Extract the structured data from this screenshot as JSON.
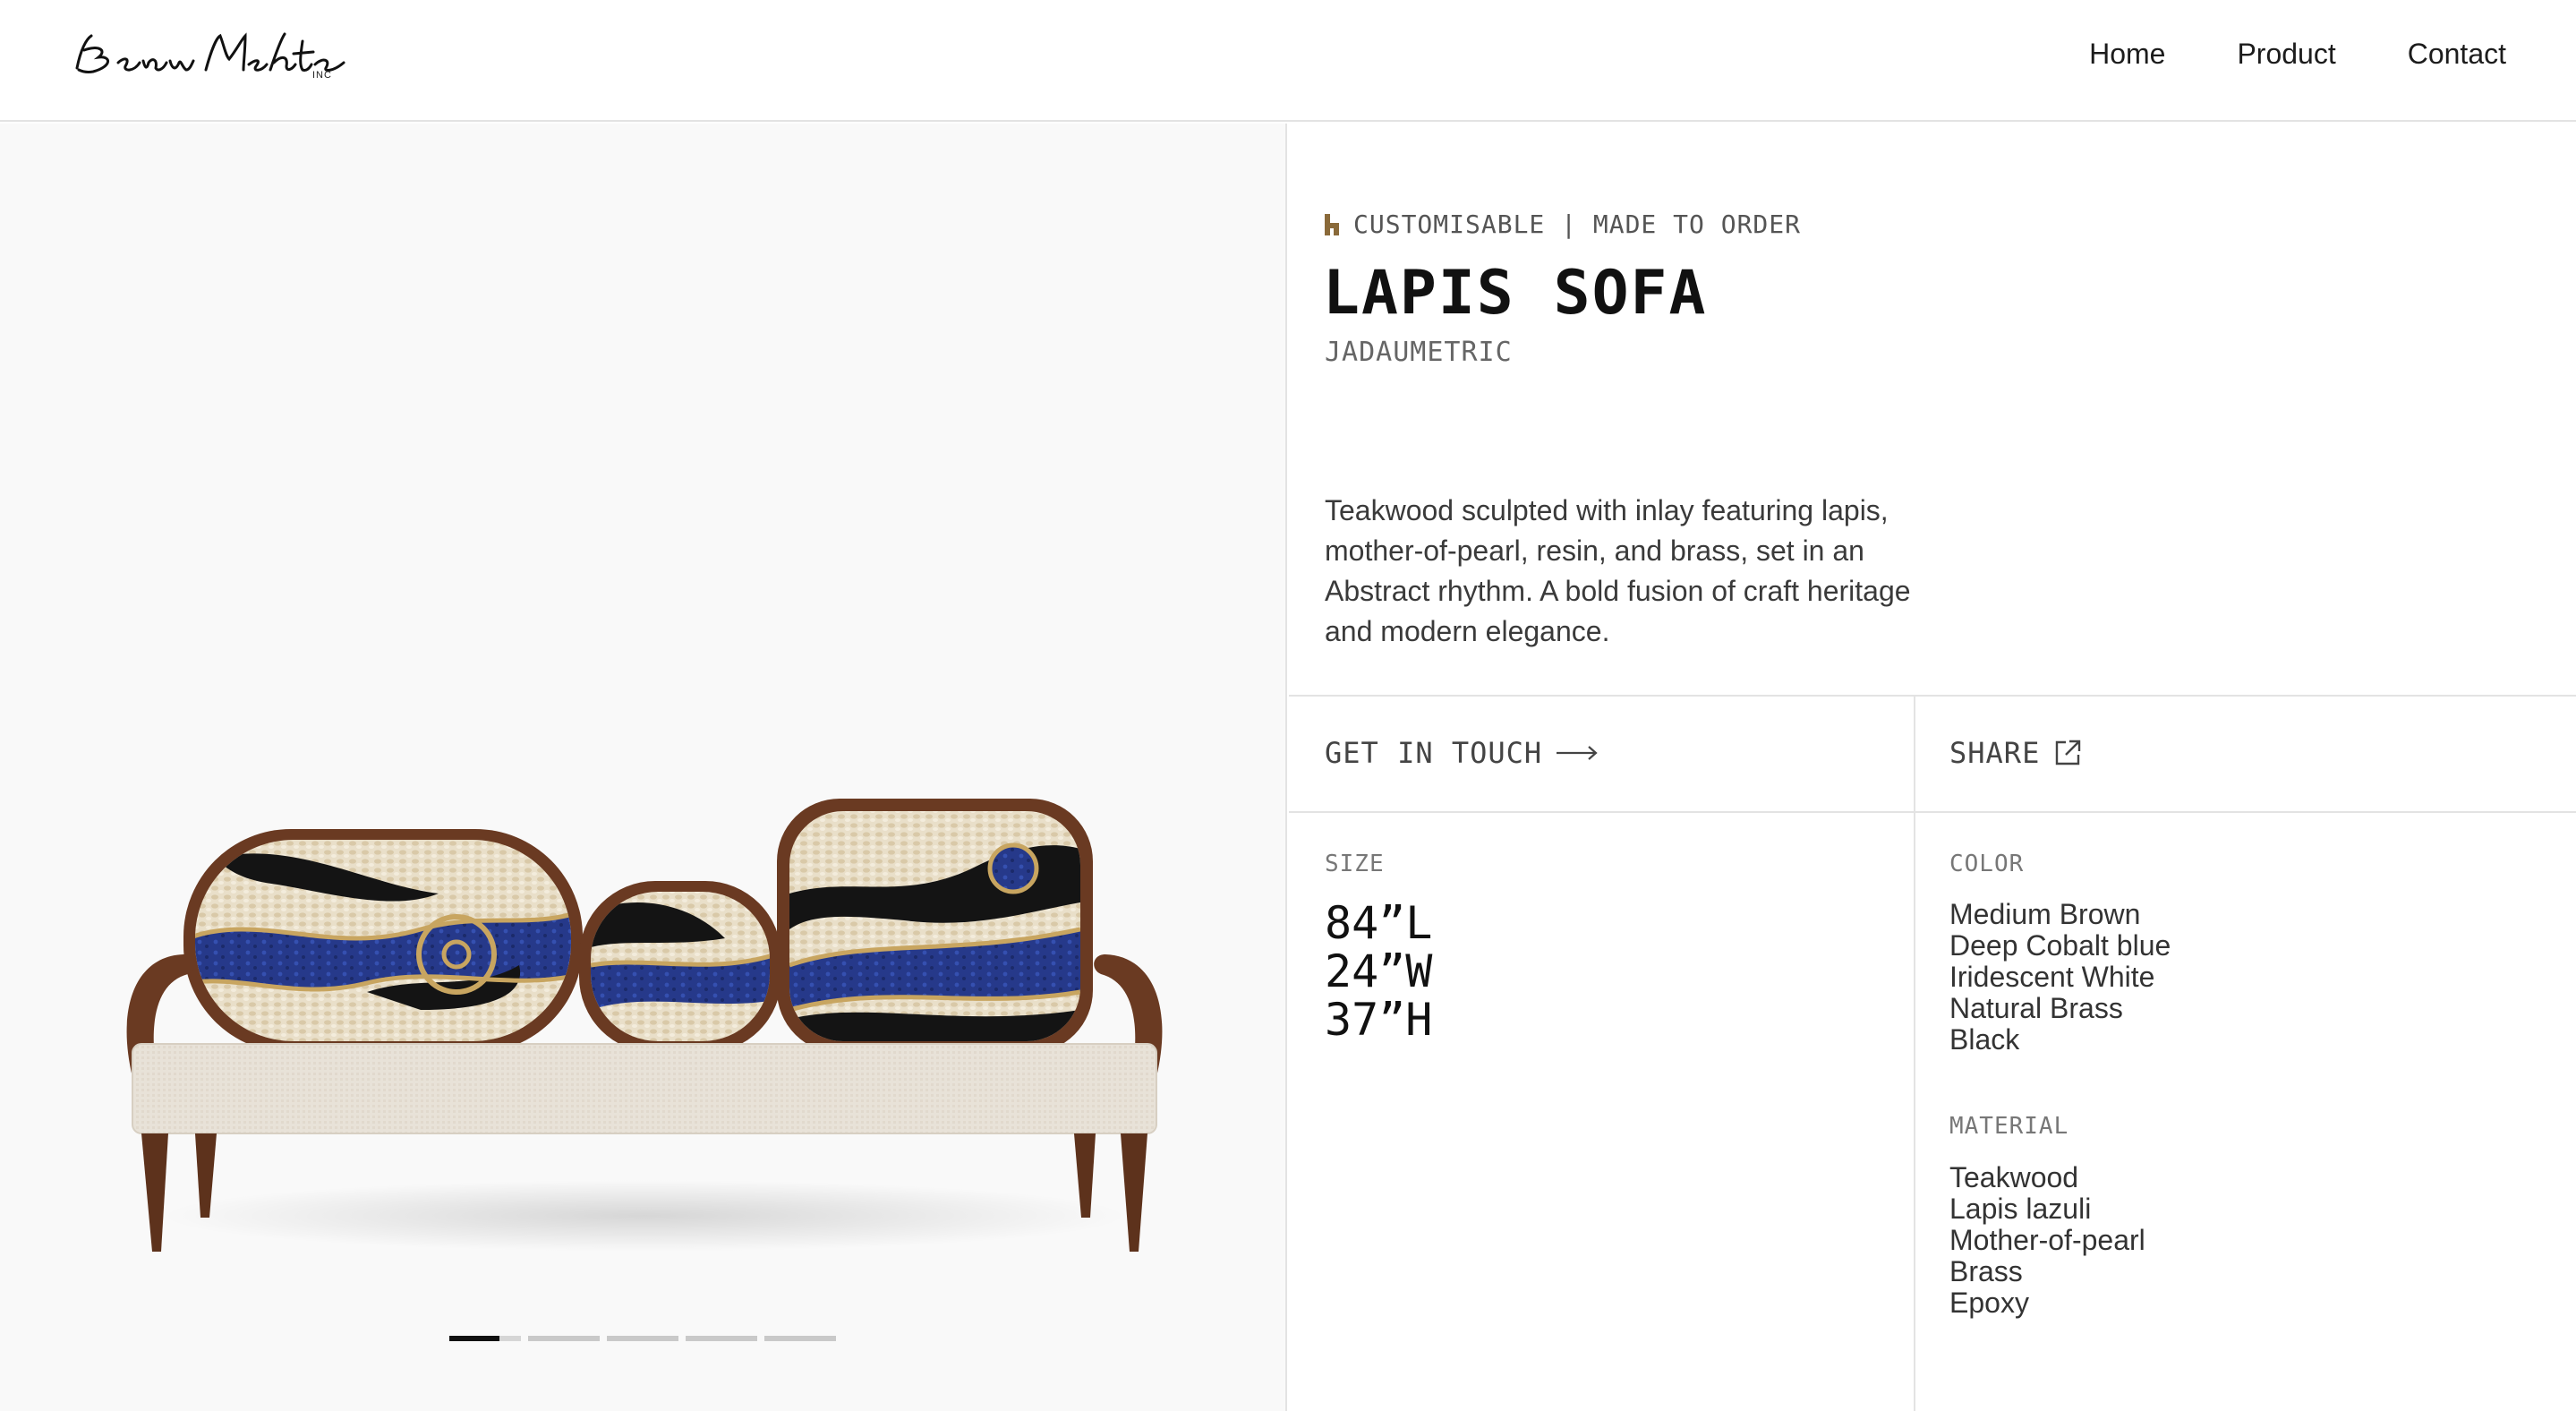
{
  "brand": {
    "logo_text": "Benu Mehta",
    "logo_suffix": "INC"
  },
  "nav": {
    "items": [
      {
        "label": "Home"
      },
      {
        "label": "Product"
      },
      {
        "label": "Contact"
      }
    ]
  },
  "gallery": {
    "slide_count": 5,
    "active_slide": 1
  },
  "product": {
    "tag": "CUSTOMISABLE | MADE TO ORDER",
    "name": "LAPIS SOFA",
    "collection": "JADAUMETRIC",
    "description": "Teakwood sculpted with inlay featuring lapis, mother-of-pearl, resin, and brass, set in an Abstract rhythm. A bold fusion of craft heritage and modern elegance."
  },
  "actions": {
    "get_in_touch": "GET IN TOUCH",
    "share": "SHARE"
  },
  "specs": {
    "size_label": "SIZE",
    "size": [
      "84”L",
      "24”W",
      "37”H"
    ],
    "color_label": "COLOR",
    "colors": [
      "Medium Brown",
      "Deep Cobalt blue",
      "Iridescent White",
      "Natural Brass",
      "Black"
    ],
    "material_label": "MATERIAL",
    "materials": [
      "Teakwood",
      "Lapis lazuli",
      "Mother-of-pearl",
      "Brass",
      "Epoxy"
    ]
  },
  "palette": {
    "wood": "#6b3a22",
    "cobalt": "#2a3c8f",
    "pearl": "#e6dcc6",
    "brass": "#c8a560",
    "black": "#141414",
    "seat": "#e9e3da"
  }
}
